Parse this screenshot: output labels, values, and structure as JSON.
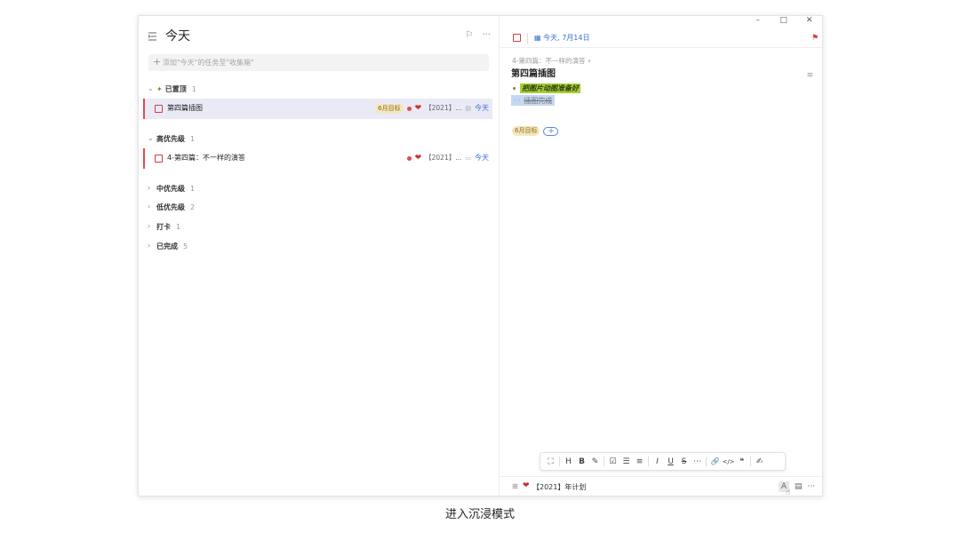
{
  "window": {
    "controls": {
      "minimize": "–",
      "maximize": "□",
      "close": "✕"
    }
  },
  "left": {
    "title": "今天",
    "add_task_placeholder": "添加\"今天\"的任务至\"收集箱\"",
    "header_icons": {
      "flag": "⚐",
      "more": "···"
    },
    "sections": [
      {
        "label": "已置顶",
        "count": "1",
        "expanded": true,
        "pinned": true
      },
      {
        "label": "高优先级",
        "count": "1",
        "expanded": true
      },
      {
        "label": "中优先级",
        "count": "1",
        "expanded": false
      },
      {
        "label": "低优先级",
        "count": "2",
        "expanded": false
      },
      {
        "label": "打卡",
        "count": "1",
        "expanded": false
      },
      {
        "label": "已完成",
        "count": "5",
        "expanded": false
      }
    ],
    "tasks": [
      {
        "title": "第四篇插图",
        "tag": "6月目标",
        "project": "【2021】...",
        "due": "今天",
        "selected": true
      },
      {
        "title": "4-第四篇：不一样的演答",
        "tag": "",
        "project": "【2021】...",
        "due": "今天",
        "selected": false
      }
    ]
  },
  "right": {
    "date": "今天, 7月14日",
    "breadcrumb": "4-第四篇：不一样的演答",
    "title": "第四篇插图",
    "bullet_text": "把图片动图准备好",
    "strike_text": "插图完成",
    "tag": "6月目标",
    "add_tag": "+",
    "toolbar": [
      "⛶",
      "H",
      "B",
      "✎",
      "☑",
      "☰",
      "≡",
      "I",
      "U",
      "S",
      "⋯",
      "🔗",
      "</>",
      "❝",
      "✍"
    ],
    "project": "【2021】年计划",
    "bottom_icons": {
      "font": "A",
      "comment": "▤",
      "more": "···"
    }
  },
  "caption": "进入沉浸模式",
  "colors": {
    "accent": "#3b6fd8",
    "priority_high": "#e14a4a",
    "highlight": "#a6cf3c",
    "selection": "#c5d8f3"
  }
}
